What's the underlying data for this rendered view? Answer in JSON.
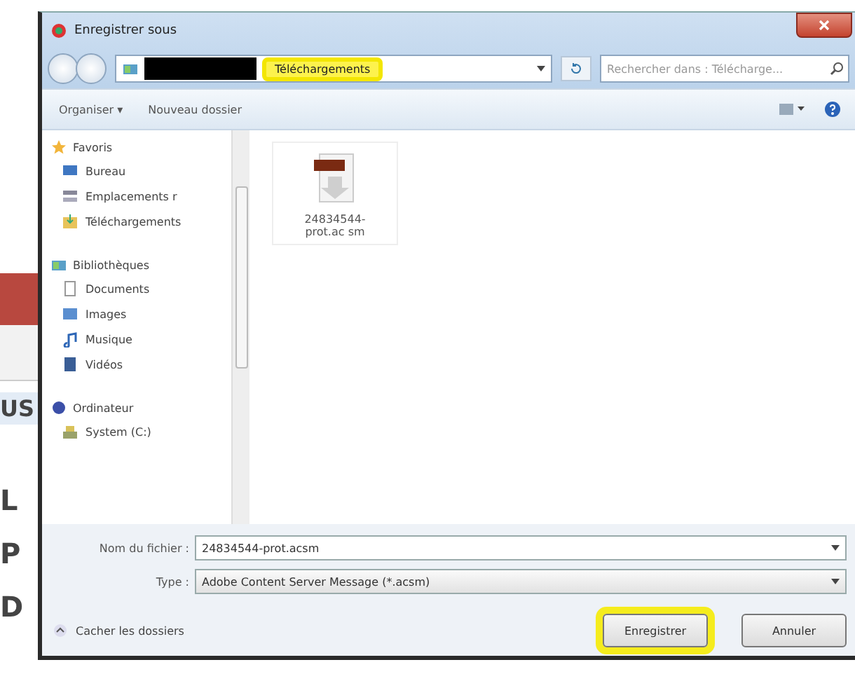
{
  "background_page": {
    "texts": [
      "US",
      "L",
      "P",
      "D"
    ]
  },
  "window": {
    "title": "Enregistrer sous"
  },
  "address_bar": {
    "crumbs": [
      {
        "label": "Téléchargements",
        "highlighted": true
      }
    ],
    "search": {
      "placeholder": "Rechercher dans : Télécharge..."
    }
  },
  "toolbar": {
    "items": [
      "Organiser ▾",
      "Nouveau dossier"
    ]
  },
  "sidebar": {
    "groups": [
      {
        "label": "Favoris",
        "children": [
          {
            "label": "Bureau"
          },
          {
            "label": "Emplacements r"
          },
          {
            "label": "Téléchargements"
          }
        ]
      },
      {
        "label": "Bibliothèques",
        "children": [
          {
            "label": "Documents"
          },
          {
            "label": "Images"
          },
          {
            "label": "Musique"
          },
          {
            "label": "Vidéos"
          }
        ]
      },
      {
        "label": "Ordinateur",
        "children": [
          {
            "label": "System (C:)"
          }
        ]
      }
    ]
  },
  "files": [
    {
      "name": "24834544-prot.ac sm"
    }
  ],
  "form": {
    "filename_label": "Nom du fichier :",
    "filename": "24834544-prot.acsm",
    "type_label": "Type :",
    "type": "Adobe Content Server Message (*.acsm)"
  },
  "footer": {
    "toggle": "Cacher les dossiers",
    "buttons": [
      {
        "label": "Enregistrer",
        "highlighted": true
      },
      {
        "label": "Annuler",
        "highlighted": false
      }
    ]
  }
}
